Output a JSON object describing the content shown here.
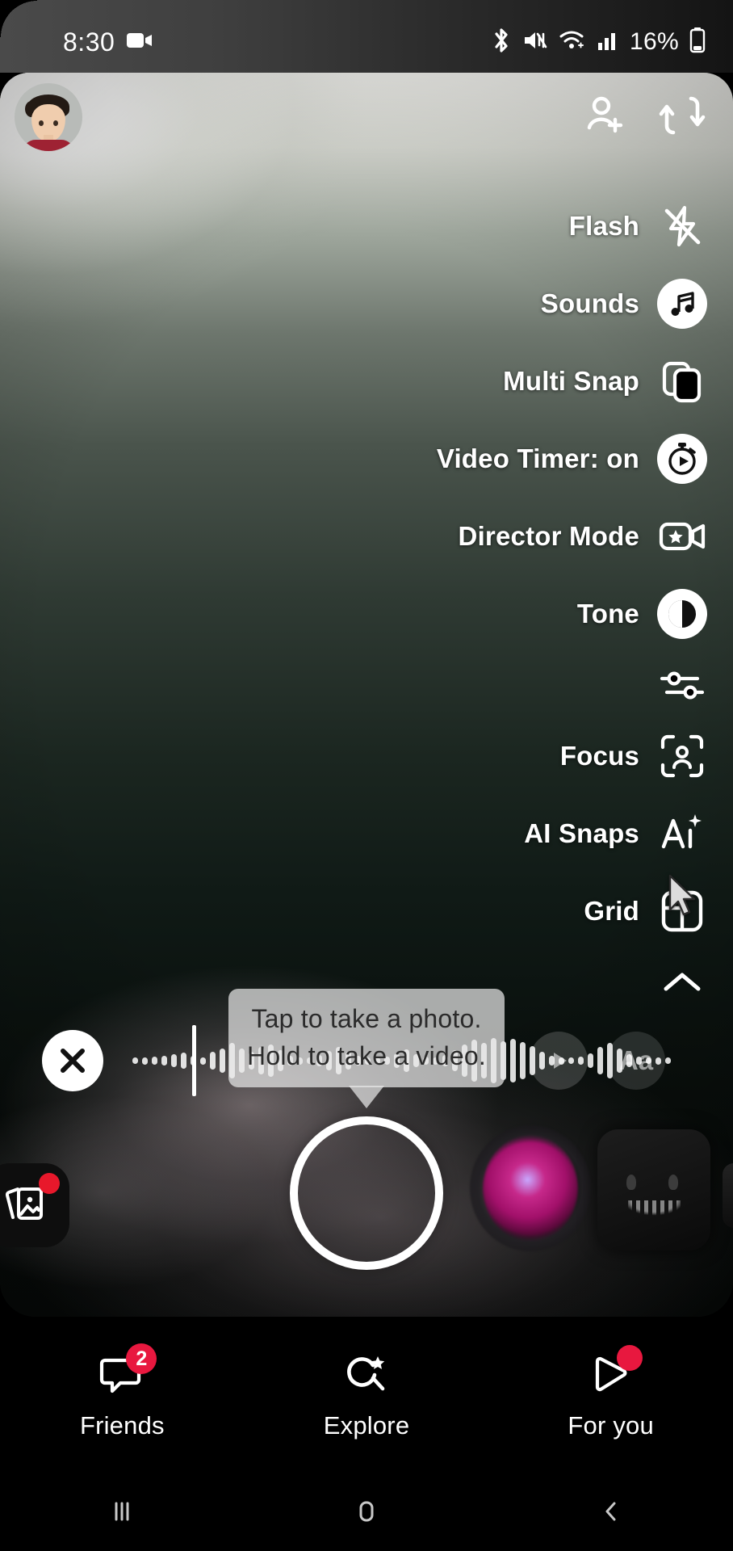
{
  "status_bar": {
    "time": "8:30",
    "battery": "16%",
    "icons": [
      "screen-record-icon",
      "bluetooth-icon",
      "mute-icon",
      "wifi-icon",
      "cellular-signal-icon",
      "battery-icon"
    ]
  },
  "top_bar": {
    "avatar_name": "bitmoji-avatar",
    "add_friend_label": "add-friend-icon",
    "flip_camera_label": "flip-camera-icon"
  },
  "camera_menu": {
    "items": [
      {
        "label": "Flash",
        "icon": "flash-off-icon",
        "filled": false
      },
      {
        "label": "Sounds",
        "icon": "music-note-icon",
        "filled": true
      },
      {
        "label": "Multi Snap",
        "icon": "multi-snap-icon",
        "filled": false
      },
      {
        "label": "Video Timer: on",
        "icon": "stopwatch-icon",
        "filled": true
      },
      {
        "label": "Director Mode",
        "icon": "director-mode-icon",
        "filled": false
      },
      {
        "label": "Tone",
        "icon": "tone-contrast-icon",
        "filled": true
      },
      {
        "label": "",
        "icon": "adjust-sliders-icon",
        "filled": false
      },
      {
        "label": "Focus",
        "icon": "focus-portrait-icon",
        "filled": false
      },
      {
        "label": "AI Snaps",
        "icon": "ai-snaps-icon",
        "filled": false
      },
      {
        "label": "Grid",
        "icon": "grid-icon",
        "filled": false
      }
    ],
    "collapse_icon": "chevron-up-icon"
  },
  "tooltip": {
    "line1": "Tap to take a photo.",
    "line2": "Hold to take a video."
  },
  "edit_strip": {
    "close_icon": "close-icon",
    "play_icon": "play-icon",
    "text_label": "Aa"
  },
  "capture": {
    "shutter_label": "shutter-button",
    "memories_label": "memories-button"
  },
  "bottom_nav": {
    "items": [
      {
        "label": "Friends",
        "icon": "chat-icon",
        "badge": "2",
        "dot": false
      },
      {
        "label": "Explore",
        "icon": "explore-icon",
        "badge": "",
        "dot": false
      },
      {
        "label": "For you",
        "icon": "for-you-icon",
        "badge": "",
        "dot": true
      }
    ]
  },
  "android_nav": {
    "recents": "recents-icon",
    "home": "home-icon",
    "back": "back-icon"
  },
  "colors": {
    "accent_red": "#e8183f",
    "badge_red": "#e8182b",
    "white": "#ffffff"
  }
}
